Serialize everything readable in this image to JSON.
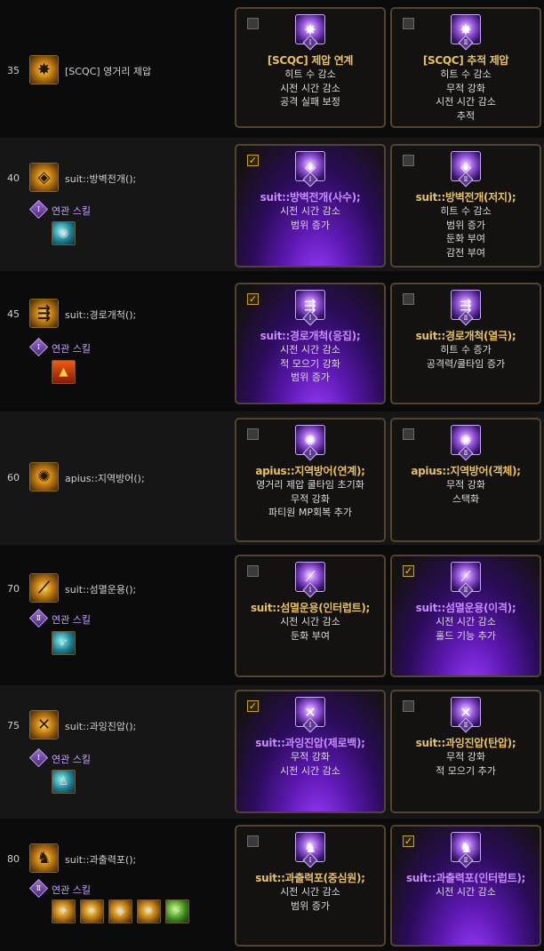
{
  "rows": [
    {
      "level": "35",
      "skill": "[SCQC] 영거리 제압",
      "icon": "thrust-skill-icon",
      "related": null,
      "related_icons": [],
      "cards": [
        {
          "checked": false,
          "roman": "Ⅰ",
          "title": "[SCQC] 제압 연계",
          "lines": [
            "히트 수 감소",
            "시전 시간 감소",
            "공격 실패 보정"
          ]
        },
        {
          "checked": false,
          "roman": "Ⅱ",
          "title": "[SCQC] 추적 제압",
          "lines": [
            "히트 수 감소",
            "무적 강화",
            "시전 시간 감소",
            "추적"
          ]
        }
      ]
    },
    {
      "level": "40",
      "skill": "suit::방벽전개();",
      "icon": "barrier-skill-icon",
      "related": {
        "roman": "Ⅰ",
        "label": "연관 스킬"
      },
      "related_icons": [
        {
          "name": "teal-orb-icon",
          "style": "teal",
          "glyph": "◉"
        }
      ],
      "cards": [
        {
          "checked": true,
          "roman": "Ⅰ",
          "title": "suit::방벽전개(사수);",
          "lines": [
            "시전 시간 감소",
            "범위 증가"
          ]
        },
        {
          "checked": false,
          "roman": "Ⅱ",
          "title": "suit::방벽전개(저지);",
          "lines": [
            "히트 수 감소",
            "범위 증가",
            "둔화 부여",
            "감전 부여"
          ]
        }
      ]
    },
    {
      "level": "45",
      "skill": "suit::경로개척();",
      "icon": "path-skill-icon",
      "related": {
        "roman": "Ⅰ",
        "label": "연관 스킬"
      },
      "related_icons": [
        {
          "name": "warning-icon",
          "style": "orange",
          "glyph": "▲"
        }
      ],
      "cards": [
        {
          "checked": true,
          "roman": "Ⅰ",
          "title": "suit::경로개척(응집);",
          "lines": [
            "시전 시간 감소",
            "적 모으기 강화",
            "범위 증가"
          ]
        },
        {
          "checked": false,
          "roman": "Ⅱ",
          "title": "suit::경로개척(열극);",
          "lines": [
            "히트 수 증가",
            "공격력/쿨타임 증가"
          ]
        }
      ]
    },
    {
      "level": "60",
      "skill": "apius::지역방어();",
      "icon": "area-defense-skill-icon",
      "related": null,
      "related_icons": [],
      "cards": [
        {
          "checked": false,
          "roman": "Ⅰ",
          "title": "apius::지역방어(연계);",
          "lines": [
            "영거리 제압 쿨타임 초기화",
            "무적 강화",
            "파티원 MP회복 추가"
          ]
        },
        {
          "checked": false,
          "roman": "Ⅱ",
          "title": "apius::지역방어(객체);",
          "lines": [
            "무적 강화",
            "스택화"
          ]
        }
      ]
    },
    {
      "level": "70",
      "skill": "suit::섬멸운용();",
      "icon": "annihilate-skill-icon",
      "related": {
        "roman": "Ⅱ",
        "label": "연관 스킬"
      },
      "related_icons": [
        {
          "name": "dash-icon",
          "style": "teal",
          "glyph": "➶"
        }
      ],
      "cards": [
        {
          "checked": false,
          "roman": "Ⅰ",
          "title": "suit::섬멸운용(인터럽트);",
          "lines": [
            "시전 시간 감소",
            "둔화 부여"
          ]
        },
        {
          "checked": true,
          "roman": "Ⅱ",
          "title": "suit::섬멸운용(이격);",
          "lines": [
            "시전 시간 감소",
            "홀드 기능 추가"
          ]
        }
      ]
    },
    {
      "level": "75",
      "skill": "suit::과잉진압();",
      "icon": "overpower-skill-icon",
      "related": {
        "roman": "Ⅰ",
        "label": "연관 스킬"
      },
      "related_icons": [
        {
          "name": "figure-icon",
          "style": "teal",
          "glyph": "♙"
        }
      ],
      "cards": [
        {
          "checked": true,
          "roman": "Ⅰ",
          "title": "suit::과잉진압(제로백);",
          "lines": [
            "무적 강화",
            "시전 시간 감소"
          ]
        },
        {
          "checked": false,
          "roman": "Ⅱ",
          "title": "suit::과잉진압(탄압);",
          "lines": [
            "무적 강화",
            "적 모으기 추가"
          ]
        }
      ]
    },
    {
      "level": "80",
      "skill": "suit::과출력포();",
      "icon": "overload-cannon-skill-icon",
      "related": {
        "roman": "Ⅱ",
        "label": "연관 스킬"
      },
      "related_icons": [
        {
          "name": "gold-skill-icon-1",
          "style": "gold",
          "glyph": "✦"
        },
        {
          "name": "gold-skill-icon-2",
          "style": "gold",
          "glyph": "✶"
        },
        {
          "name": "gold-skill-icon-3",
          "style": "gold",
          "glyph": "◈"
        },
        {
          "name": "gold-skill-icon-4",
          "style": "gold",
          "glyph": "✷"
        },
        {
          "name": "green-skill-icon",
          "style": "green",
          "glyph": "⚡"
        }
      ],
      "cards": [
        {
          "checked": false,
          "roman": "Ⅰ",
          "title": "suit::과출력포(중심원);",
          "lines": [
            "시전 시간 감소",
            "범위 증가"
          ]
        },
        {
          "checked": true,
          "roman": "Ⅱ",
          "title": "suit::과출력포(인터럽트);",
          "lines": [
            "시전 시간 감소"
          ]
        }
      ]
    }
  ]
}
